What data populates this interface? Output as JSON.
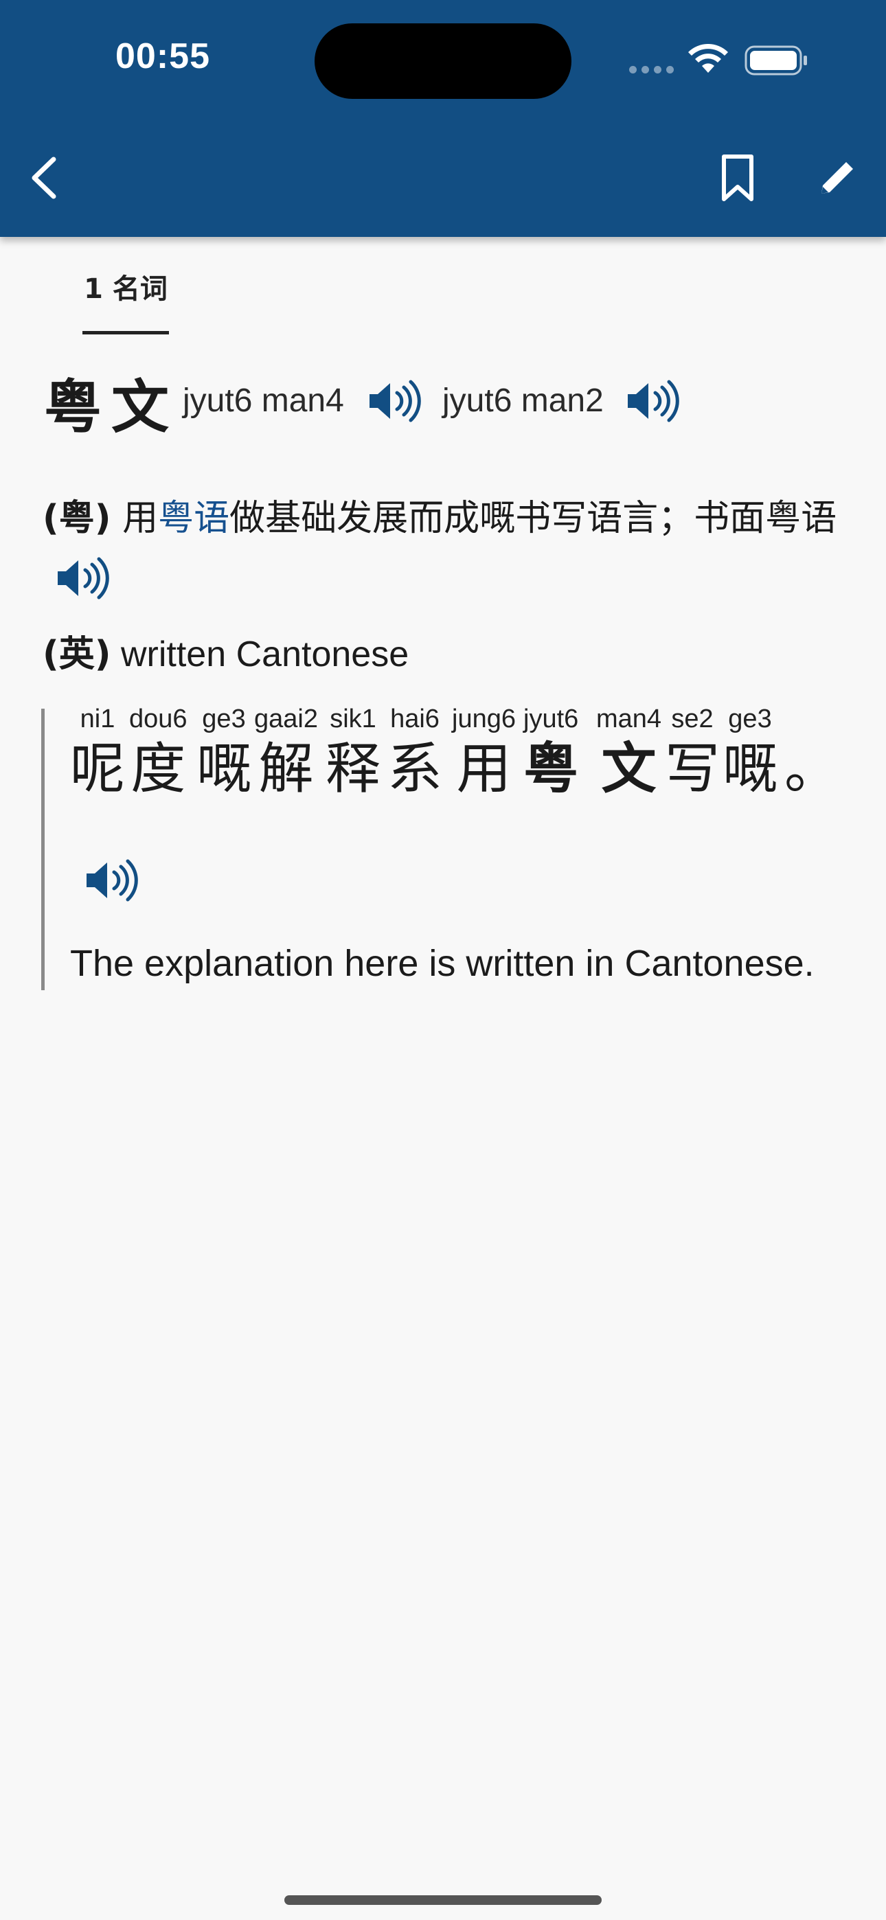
{
  "status_bar": {
    "time": "00:55"
  },
  "nav": {
    "back_icon": "chevron-left-icon",
    "bookmark_icon": "bookmark-icon",
    "edit_icon": "pencil-icon"
  },
  "tabs": [
    {
      "label": "1 名词",
      "selected": true
    }
  ],
  "entry": {
    "headword": "粤文",
    "pronunciations": [
      "jyut6 man4",
      "jyut6 man2"
    ],
    "definition_yue": {
      "lang": "(粤)",
      "prefix": " 用",
      "link": "粤语",
      "rest": "做基础发展而成嘅书写语言；书面粤语"
    },
    "definition_en": {
      "lang": "(英)",
      "text": " written Cantonese"
    },
    "example": {
      "tokens": [
        {
          "jyutping": "ni1",
          "char": "呢",
          "bold": false
        },
        {
          "jyutping": "dou6",
          "char": "度",
          "bold": false
        },
        {
          "jyutping": "ge3",
          "char": "嘅",
          "bold": false
        },
        {
          "jyutping": "gaai2",
          "char": "解",
          "bold": false
        },
        {
          "jyutping": "sik1",
          "char": "释",
          "bold": false
        },
        {
          "jyutping": "hai6",
          "char": "系",
          "bold": false
        },
        {
          "jyutping": "jung6",
          "char": "用",
          "bold": false
        },
        {
          "jyutping": "jyut6",
          "char": "粤",
          "bold": true
        },
        {
          "jyutping": "man4",
          "char": "文",
          "bold": true
        },
        {
          "jyutping": "se2",
          "char": "写",
          "bold": false
        },
        {
          "jyutping": "ge3",
          "char": "嘅",
          "bold": false
        },
        {
          "jyutping": "",
          "char": "。",
          "bold": false
        }
      ],
      "translation": "The explanation here is written in Cantonese."
    }
  },
  "colors": {
    "header": "#124e83",
    "link": "#15508f",
    "speaker": "#124e83"
  }
}
